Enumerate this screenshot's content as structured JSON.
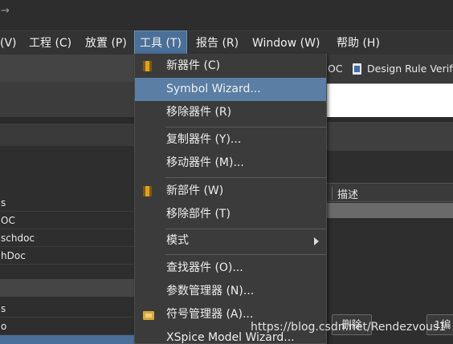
{
  "titlebar": {
    "glyph": "→"
  },
  "menubar": {
    "items": [
      {
        "label": "(V)"
      },
      {
        "label": "工程 (C)"
      },
      {
        "label": "放置 (P)"
      },
      {
        "label": "工具 (T)"
      },
      {
        "label": "报告 (R)"
      },
      {
        "label": "Window (W)"
      },
      {
        "label": "帮助 (H)"
      }
    ]
  },
  "tools_menu": {
    "items": [
      {
        "label": "新器件 (C)",
        "icon": "component-chip-icon"
      },
      {
        "label": "Symbol Wizard...",
        "highlighted": true
      },
      {
        "label": "移除器件 (R)"
      },
      {
        "label": "复制器件 (Y)..."
      },
      {
        "label": "移动器件 (M)..."
      },
      {
        "label": "新部件 (W)",
        "icon": "component-chip-icon"
      },
      {
        "label": "移除部件 (T)"
      },
      {
        "label": "模式",
        "submenu": true
      },
      {
        "label": "查找器件 (O)..."
      },
      {
        "label": "参数管理器 (N)..."
      },
      {
        "label": "符号管理器 (A)...",
        "icon": "folder-icon"
      },
      {
        "label": "XSpice Model Wizard..."
      }
    ]
  },
  "left_panel": {
    "rows": [
      "s",
      "OC",
      "schdoc",
      "hDoc"
    ],
    "rows2": [
      "s",
      "o"
    ]
  },
  "doc_tabs": [
    {
      "label": "OC"
    },
    {
      "label": "Design Rule Verifi"
    }
  ],
  "table": {
    "column": "描述"
  },
  "buttons": {
    "delete": "删除",
    "next": "1编"
  },
  "watermark": "https://blog.csdn.net/Rendezvous1"
}
